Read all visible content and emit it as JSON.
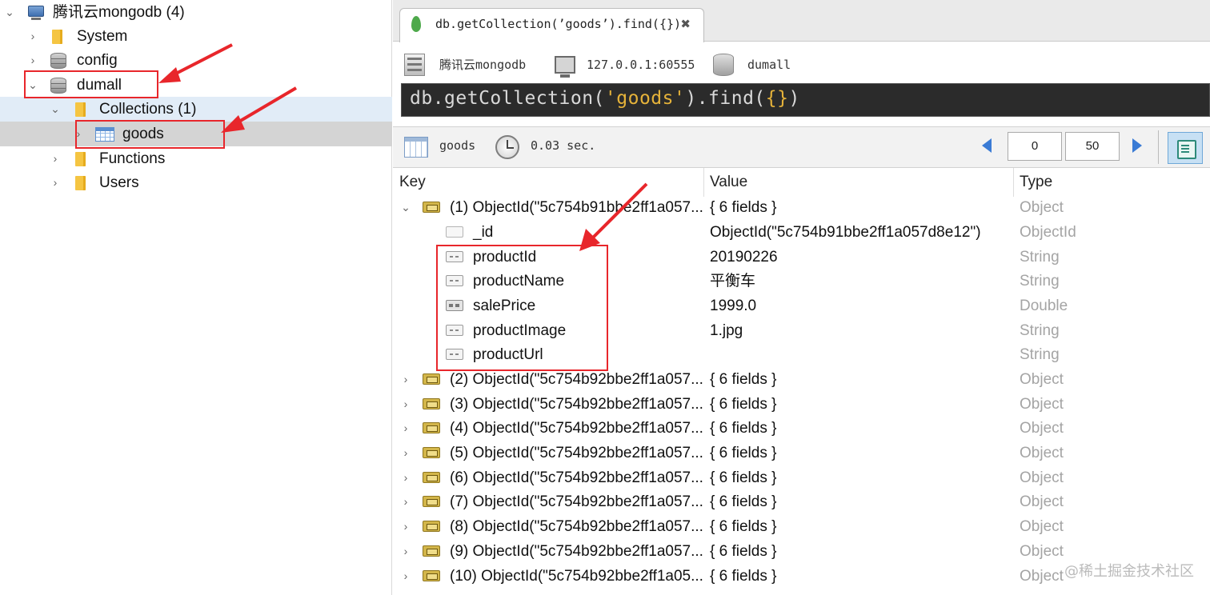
{
  "tree": {
    "server_label": "腾讯云mongodb (4)",
    "items": [
      {
        "label": "System",
        "icon": "folder-icon"
      },
      {
        "label": "config",
        "icon": "database-icon"
      },
      {
        "label": "dumall",
        "icon": "database-icon"
      },
      {
        "label": "Collections (1)",
        "icon": "folder-icon"
      },
      {
        "label": "goods",
        "icon": "table-icon"
      },
      {
        "label": "Functions",
        "icon": "folder-icon"
      },
      {
        "label": "Users",
        "icon": "folder-icon"
      }
    ]
  },
  "tab": {
    "title": "db.getCollection(’goods’).find({})",
    "close": "✖"
  },
  "connection": {
    "server": "腾讯云mongodb",
    "host": "127.0.0.1:60555",
    "database": "dumall"
  },
  "query": {
    "prefix": "db.getCollection(",
    "string": "'goods'",
    "middle": ").find(",
    "braces": "{}",
    "suffix": ")"
  },
  "results": {
    "collection": "goods",
    "time": "0.03 sec.",
    "page_start": "0",
    "page_size": "50"
  },
  "grid": {
    "headers": {
      "key": "Key",
      "value": "Value",
      "type": "Type"
    },
    "rows": [
      {
        "key": "(1) ObjectId(\"5c754b91bbe2ff1a057...",
        "value": "{ 6 fields }",
        "type": "Object"
      },
      {
        "key": "_id",
        "value": "ObjectId(\"5c754b91bbe2ff1a057d8e12\")",
        "type": "ObjectId"
      },
      {
        "key": "productId",
        "value": "20190226",
        "type": "String"
      },
      {
        "key": "productName",
        "value": "平衡车",
        "type": "String"
      },
      {
        "key": "salePrice",
        "value": "1999.0",
        "type": "Double"
      },
      {
        "key": "productImage",
        "value": "1.jpg",
        "type": "String"
      },
      {
        "key": "productUrl",
        "value": "",
        "type": "String"
      },
      {
        "key": "(2) ObjectId(\"5c754b92bbe2ff1a057...",
        "value": "{ 6 fields }",
        "type": "Object"
      },
      {
        "key": "(3) ObjectId(\"5c754b92bbe2ff1a057...",
        "value": "{ 6 fields }",
        "type": "Object"
      },
      {
        "key": "(4) ObjectId(\"5c754b92bbe2ff1a057...",
        "value": "{ 6 fields }",
        "type": "Object"
      },
      {
        "key": "(5) ObjectId(\"5c754b92bbe2ff1a057...",
        "value": "{ 6 fields }",
        "type": "Object"
      },
      {
        "key": "(6) ObjectId(\"5c754b92bbe2ff1a057...",
        "value": "{ 6 fields }",
        "type": "Object"
      },
      {
        "key": "(7) ObjectId(\"5c754b92bbe2ff1a057...",
        "value": "{ 6 fields }",
        "type": "Object"
      },
      {
        "key": "(8) ObjectId(\"5c754b92bbe2ff1a057...",
        "value": "{ 6 fields }",
        "type": "Object"
      },
      {
        "key": "(9) ObjectId(\"5c754b92bbe2ff1a057...",
        "value": "{ 6 fields }",
        "type": "Object"
      },
      {
        "key": "(10) ObjectId(\"5c754b92bbe2ff1a05...",
        "value": "{ 6 fields }",
        "type": "Object"
      }
    ]
  },
  "watermark": "@稀土掘金技术社区",
  "colors": {
    "annotation_red": "#e8262b",
    "query_bg": "#2b2b2b",
    "query_string": "#e6b33a",
    "type_gray": "#a4a4a4",
    "selected_row": "#d4d4d4"
  }
}
